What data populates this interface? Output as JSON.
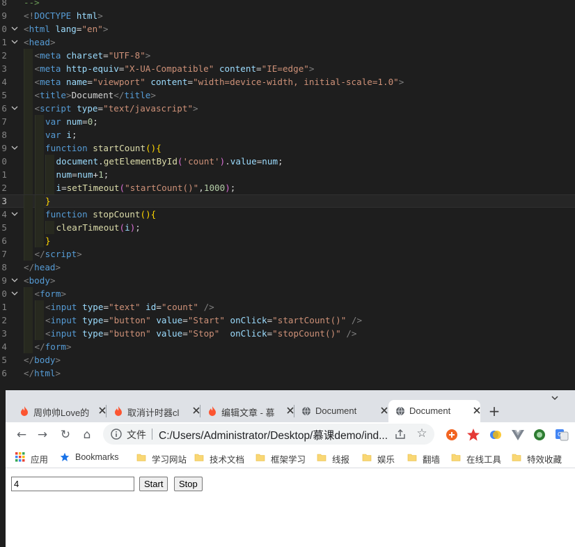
{
  "editor": {
    "lines": [
      {
        "num": "8",
        "indent": 0,
        "fold": "",
        "current": false,
        "segs": [
          [
            "c",
            "-->"
          ]
        ]
      },
      {
        "num": "9",
        "indent": 0,
        "fold": "",
        "current": false,
        "segs": [
          [
            "p",
            "<!"
          ],
          [
            "t",
            "DOCTYPE"
          ],
          [
            "w",
            " "
          ],
          [
            "a",
            "html"
          ],
          [
            "p",
            ">"
          ]
        ]
      },
      {
        "num": "0",
        "indent": 0,
        "fold": "v",
        "current": false,
        "segs": [
          [
            "p",
            "<"
          ],
          [
            "t",
            "html"
          ],
          [
            "w",
            " "
          ],
          [
            "a",
            "lang"
          ],
          [
            "w",
            "="
          ],
          [
            "s",
            "\"en\""
          ],
          [
            "p",
            ">"
          ]
        ]
      },
      {
        "num": "1",
        "indent": 0,
        "fold": "v",
        "current": false,
        "segs": [
          [
            "p",
            "<"
          ],
          [
            "t",
            "head"
          ],
          [
            "p",
            ">"
          ]
        ]
      },
      {
        "num": "2",
        "indent": 1,
        "fold": "",
        "current": false,
        "segs": [
          [
            "p",
            "<"
          ],
          [
            "t",
            "meta"
          ],
          [
            "w",
            " "
          ],
          [
            "a",
            "charset"
          ],
          [
            "w",
            "="
          ],
          [
            "s",
            "\"UTF-8\""
          ],
          [
            "p",
            ">"
          ]
        ]
      },
      {
        "num": "3",
        "indent": 1,
        "fold": "",
        "current": false,
        "segs": [
          [
            "p",
            "<"
          ],
          [
            "t",
            "meta"
          ],
          [
            "w",
            " "
          ],
          [
            "a",
            "http-equiv"
          ],
          [
            "w",
            "="
          ],
          [
            "s",
            "\"X-UA-Compatible\""
          ],
          [
            "w",
            " "
          ],
          [
            "a",
            "content"
          ],
          [
            "w",
            "="
          ],
          [
            "s",
            "\"IE=edge\""
          ],
          [
            "p",
            ">"
          ]
        ]
      },
      {
        "num": "4",
        "indent": 1,
        "fold": "",
        "current": false,
        "segs": [
          [
            "p",
            "<"
          ],
          [
            "t",
            "meta"
          ],
          [
            "w",
            " "
          ],
          [
            "a",
            "name"
          ],
          [
            "w",
            "="
          ],
          [
            "s",
            "\"viewport\""
          ],
          [
            "w",
            " "
          ],
          [
            "a",
            "content"
          ],
          [
            "w",
            "="
          ],
          [
            "s",
            "\"width=device-width, initial-scale=1.0\""
          ],
          [
            "p",
            ">"
          ]
        ]
      },
      {
        "num": "5",
        "indent": 1,
        "fold": "",
        "current": false,
        "segs": [
          [
            "p",
            "<"
          ],
          [
            "t",
            "title"
          ],
          [
            "p",
            ">"
          ],
          [
            "txt",
            "Document"
          ],
          [
            "p",
            "</"
          ],
          [
            "t",
            "title"
          ],
          [
            "p",
            ">"
          ]
        ]
      },
      {
        "num": "6",
        "indent": 1,
        "fold": "v",
        "current": false,
        "segs": [
          [
            "p",
            "<"
          ],
          [
            "t",
            "script"
          ],
          [
            "w",
            " "
          ],
          [
            "a",
            "type"
          ],
          [
            "w",
            "="
          ],
          [
            "s",
            "\"text/javascript\""
          ],
          [
            "p",
            ">"
          ]
        ]
      },
      {
        "num": "7",
        "indent": 2,
        "fold": "",
        "current": false,
        "segs": [
          [
            "k",
            "var"
          ],
          [
            "w",
            " "
          ],
          [
            "v",
            "num"
          ],
          [
            "w",
            "="
          ],
          [
            "n",
            "0"
          ],
          [
            "w",
            ";"
          ]
        ]
      },
      {
        "num": "8",
        "indent": 2,
        "fold": "",
        "current": false,
        "segs": [
          [
            "k",
            "var"
          ],
          [
            "w",
            " "
          ],
          [
            "v",
            "i"
          ],
          [
            "w",
            ";"
          ]
        ]
      },
      {
        "num": "9",
        "indent": 2,
        "fold": "v",
        "current": false,
        "segs": [
          [
            "k",
            "function"
          ],
          [
            "w",
            " "
          ],
          [
            "f",
            "startCount"
          ],
          [
            "y",
            "(){"
          ]
        ]
      },
      {
        "num": "0",
        "indent": 3,
        "fold": "",
        "current": false,
        "segs": [
          [
            "v",
            "document"
          ],
          [
            "w",
            "."
          ],
          [
            "f",
            "getElementById"
          ],
          [
            "m",
            "("
          ],
          [
            "s",
            "'count'"
          ],
          [
            "m",
            ")"
          ],
          [
            "w",
            "."
          ],
          [
            "v",
            "value"
          ],
          [
            "w",
            "="
          ],
          [
            "v",
            "num"
          ],
          [
            "w",
            ";"
          ]
        ]
      },
      {
        "num": "1",
        "indent": 3,
        "fold": "",
        "current": false,
        "segs": [
          [
            "v",
            "num"
          ],
          [
            "w",
            "="
          ],
          [
            "v",
            "num"
          ],
          [
            "w",
            "+"
          ],
          [
            "n",
            "1"
          ],
          [
            "w",
            ";"
          ]
        ]
      },
      {
        "num": "2",
        "indent": 3,
        "fold": "",
        "current": false,
        "segs": [
          [
            "v",
            "i"
          ],
          [
            "w",
            "="
          ],
          [
            "f",
            "setTimeout"
          ],
          [
            "m",
            "("
          ],
          [
            "s",
            "\"startCount()\""
          ],
          [
            "w",
            ","
          ],
          [
            "n",
            "1000"
          ],
          [
            "m",
            ")"
          ],
          [
            "w",
            ";"
          ]
        ]
      },
      {
        "num": "3",
        "indent": 2,
        "fold": "",
        "current": true,
        "segs": [
          [
            "y",
            "}"
          ]
        ]
      },
      {
        "num": "4",
        "indent": 2,
        "fold": "v",
        "current": false,
        "segs": [
          [
            "k",
            "function"
          ],
          [
            "w",
            " "
          ],
          [
            "f",
            "stopCount"
          ],
          [
            "y",
            "(){"
          ]
        ]
      },
      {
        "num": "5",
        "indent": 3,
        "fold": "",
        "current": false,
        "segs": [
          [
            "f",
            "clearTimeout"
          ],
          [
            "m",
            "("
          ],
          [
            "v",
            "i"
          ],
          [
            "m",
            ")"
          ],
          [
            "w",
            ";"
          ]
        ]
      },
      {
        "num": "6",
        "indent": 2,
        "fold": "",
        "current": false,
        "segs": [
          [
            "y",
            "}"
          ]
        ]
      },
      {
        "num": "7",
        "indent": 1,
        "fold": "",
        "current": false,
        "segs": [
          [
            "p",
            "</"
          ],
          [
            "t",
            "script"
          ],
          [
            "p",
            ">"
          ]
        ]
      },
      {
        "num": "8",
        "indent": 0,
        "fold": "",
        "current": false,
        "segs": [
          [
            "p",
            "</"
          ],
          [
            "t",
            "head"
          ],
          [
            "p",
            ">"
          ]
        ]
      },
      {
        "num": "9",
        "indent": 0,
        "fold": "v",
        "current": false,
        "segs": [
          [
            "p",
            "<"
          ],
          [
            "t",
            "body"
          ],
          [
            "p",
            ">"
          ]
        ]
      },
      {
        "num": "0",
        "indent": 1,
        "fold": "v",
        "current": false,
        "segs": [
          [
            "p",
            "<"
          ],
          [
            "t",
            "form"
          ],
          [
            "p",
            ">"
          ]
        ]
      },
      {
        "num": "1",
        "indent": 2,
        "fold": "",
        "current": false,
        "segs": [
          [
            "p",
            "<"
          ],
          [
            "t",
            "input"
          ],
          [
            "w",
            " "
          ],
          [
            "a",
            "type"
          ],
          [
            "w",
            "="
          ],
          [
            "s",
            "\"text\""
          ],
          [
            "w",
            " "
          ],
          [
            "a",
            "id"
          ],
          [
            "w",
            "="
          ],
          [
            "s",
            "\"count\""
          ],
          [
            "w",
            " "
          ],
          [
            "p",
            "/>"
          ]
        ]
      },
      {
        "num": "2",
        "indent": 2,
        "fold": "",
        "current": false,
        "segs": [
          [
            "p",
            "<"
          ],
          [
            "t",
            "input"
          ],
          [
            "w",
            " "
          ],
          [
            "a",
            "type"
          ],
          [
            "w",
            "="
          ],
          [
            "s",
            "\"button\""
          ],
          [
            "w",
            " "
          ],
          [
            "a",
            "value"
          ],
          [
            "w",
            "="
          ],
          [
            "s",
            "\"Start\""
          ],
          [
            "w",
            " "
          ],
          [
            "a",
            "onClick"
          ],
          [
            "w",
            "="
          ],
          [
            "s",
            "\"startCount()\""
          ],
          [
            "w",
            " "
          ],
          [
            "p",
            "/>"
          ]
        ]
      },
      {
        "num": "3",
        "indent": 2,
        "fold": "",
        "current": false,
        "segs": [
          [
            "p",
            "<"
          ],
          [
            "t",
            "input"
          ],
          [
            "w",
            " "
          ],
          [
            "a",
            "type"
          ],
          [
            "w",
            "="
          ],
          [
            "s",
            "\"button\""
          ],
          [
            "w",
            " "
          ],
          [
            "a",
            "value"
          ],
          [
            "w",
            "="
          ],
          [
            "s",
            "\"Stop\""
          ],
          [
            "w",
            "  "
          ],
          [
            "a",
            "onClick"
          ],
          [
            "w",
            "="
          ],
          [
            "s",
            "\"stopCount()\""
          ],
          [
            "w",
            " "
          ],
          [
            "p",
            "/>"
          ]
        ]
      },
      {
        "num": "4",
        "indent": 1,
        "fold": "",
        "current": false,
        "segs": [
          [
            "p",
            "</"
          ],
          [
            "t",
            "form"
          ],
          [
            "p",
            ">"
          ]
        ]
      },
      {
        "num": "5",
        "indent": 0,
        "fold": "",
        "current": false,
        "segs": [
          [
            "p",
            "</"
          ],
          [
            "t",
            "body"
          ],
          [
            "p",
            ">"
          ]
        ]
      },
      {
        "num": "6",
        "indent": 0,
        "fold": "",
        "current": false,
        "segs": [
          [
            "p",
            "</"
          ],
          [
            "t",
            "html"
          ],
          [
            "p",
            ">"
          ]
        ]
      }
    ]
  },
  "browser": {
    "tabs": [
      {
        "title": "周帅帅Love的",
        "icon": "flame-icon",
        "active": false
      },
      {
        "title": "取消计时器cl",
        "icon": "flame-icon",
        "active": false
      },
      {
        "title": "编辑文章 - 慕",
        "icon": "flame-icon",
        "active": false
      },
      {
        "title": "Document",
        "icon": "globe-icon",
        "active": false
      },
      {
        "title": "Document",
        "icon": "globe-icon",
        "active": true
      }
    ],
    "new_tab": "+",
    "nav": {
      "back": "←",
      "forward": "→",
      "reload": "↻",
      "home": "⌂"
    },
    "address": {
      "scheme_label": "文件",
      "url": "C:/Users/Administrator/Desktop/慕课demo/ind..."
    },
    "bookmarks": [
      {
        "label": "应用",
        "icon": "apps-grid-icon"
      },
      {
        "label": "Bookmarks",
        "icon": "star-icon"
      },
      {
        "label": "学习网站",
        "icon": "folder-icon"
      },
      {
        "label": "技术文档",
        "icon": "folder-icon"
      },
      {
        "label": "框架学习",
        "icon": "folder-icon"
      },
      {
        "label": "线报",
        "icon": "folder-icon"
      },
      {
        "label": "娱乐",
        "icon": "folder-icon"
      },
      {
        "label": "翻墙",
        "icon": "folder-icon"
      },
      {
        "label": "在线工具",
        "icon": "folder-icon"
      },
      {
        "label": "特效收藏",
        "icon": "folder-icon"
      }
    ],
    "page": {
      "count_value": "4",
      "start_label": "Start",
      "stop_label": "Stop"
    }
  },
  "colors": {
    "editor_bg": "#1e1e1e",
    "tag": "#569cd6",
    "attr": "#9cdcfe",
    "string": "#ce9178",
    "function": "#dcdcaa",
    "number": "#b5cea8",
    "tabstrip_bg": "#dee1e6",
    "folder": "#f9d774"
  }
}
